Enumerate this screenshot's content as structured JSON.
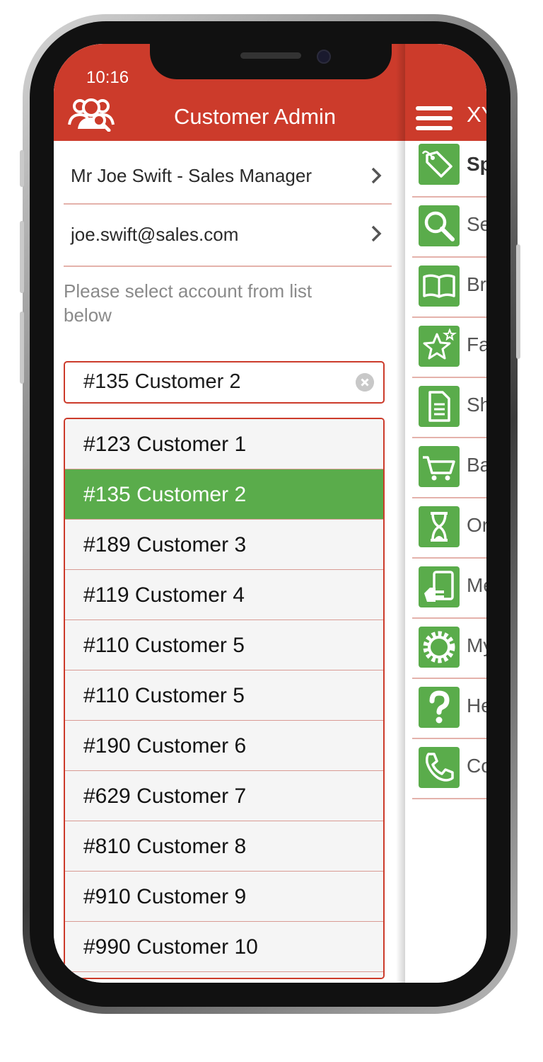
{
  "status_bar": {
    "time": "10:16"
  },
  "header": {
    "title": "Customer Admin",
    "admin_icon": "user-admin-icon"
  },
  "user": {
    "name_role": "Mr Joe Swift - Sales Manager",
    "email": "joe.swift@sales.com"
  },
  "instruction": "Please select account from list below",
  "search": {
    "value": "#135 Customer 2",
    "clear_icon": "clear-icon"
  },
  "accounts": [
    {
      "label": "#123 Customer 1"
    },
    {
      "label": "#135 Customer 2",
      "selected": true
    },
    {
      "label": "#189 Customer 3"
    },
    {
      "label": "#119 Customer 4"
    },
    {
      "label": "#110 Customer 5"
    },
    {
      "label": "#110 Customer 5"
    },
    {
      "label": "#190 Customer 6"
    },
    {
      "label": "#629 Customer 7"
    },
    {
      "label": "#810 Customer 8"
    },
    {
      "label": "#910 Customer 9"
    },
    {
      "label": "#990 Customer 10"
    },
    {
      "label": ""
    }
  ],
  "side_menu": {
    "header_text": "XY",
    "items": [
      {
        "label": "Sp",
        "icon": "tag-icon",
        "bold": true
      },
      {
        "label": "Se",
        "icon": "search-icon"
      },
      {
        "label": "Br",
        "icon": "book-icon"
      },
      {
        "label": "Fa",
        "icon": "favourite-star-icon"
      },
      {
        "label": "Sh",
        "icon": "document-icon"
      },
      {
        "label": "Ba",
        "icon": "basket-icon"
      },
      {
        "label": "Or",
        "icon": "hourglass-icon"
      },
      {
        "label": "Me",
        "icon": "message-hand-icon"
      },
      {
        "label": "My",
        "icon": "settings-gear-icon"
      },
      {
        "label": "He",
        "icon": "help-icon"
      },
      {
        "label": "Co",
        "icon": "phone-icon"
      }
    ]
  },
  "colors": {
    "brand_red": "#cc3b2b",
    "selected_green": "#5aac4b",
    "menu_icon_green": "#5aac4b"
  }
}
